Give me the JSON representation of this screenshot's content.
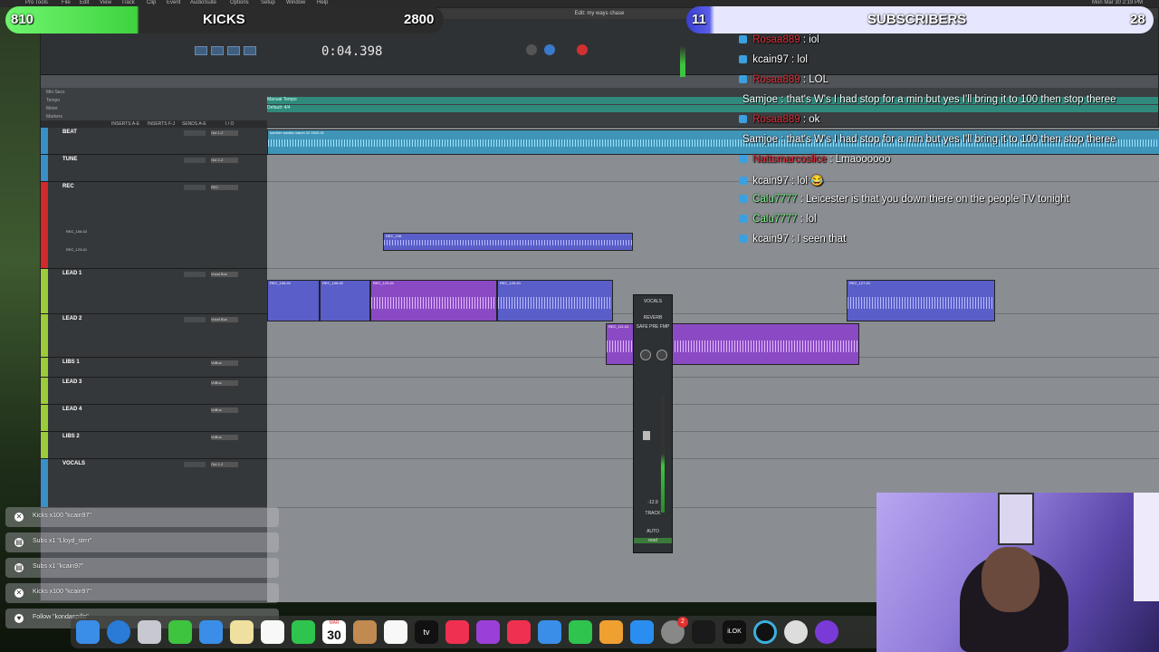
{
  "menubar": {
    "items": [
      "Pro Tools",
      "File",
      "Edit",
      "View",
      "Track",
      "Clip",
      "Event",
      "AudioSuite",
      "Options",
      "Setup",
      "Window",
      "Help"
    ],
    "clock": "Mon Mar 30  2:19 PM"
  },
  "protools": {
    "window_title": "Edit: my ways chase",
    "counter": "0:04.398",
    "track_columns": [
      "INSERTS A-E",
      "INSERTS F-J",
      "SENDS A-E",
      "I / O"
    ],
    "rulers": [
      "Min:Secs",
      "Tempo",
      "Meter",
      "Markers"
    ],
    "tempo_text": "Manual Tempo",
    "meter_text": "Default: 4/4",
    "tracks": [
      {
        "name": "BEAT",
        "color": "#3a8fc4",
        "io": "Out 1-2"
      },
      {
        "name": "TUNE",
        "color": "#3a8fc4",
        "io": "Out 1-2"
      },
      {
        "name": "REC",
        "color": "#d02a2a",
        "io": "REC"
      },
      {
        "name": "LEAD 1",
        "color": "#9bcc3a",
        "io": "Vocal Bus"
      },
      {
        "name": "LEAD 2",
        "color": "#9bcc3a",
        "io": "Vocal Bus"
      },
      {
        "name": "LIBS 1",
        "color": "#9bcc3a",
        "io": "VoBus"
      },
      {
        "name": "LEAD 3",
        "color": "#9bcc3a",
        "io": "VoBus"
      },
      {
        "name": "LEAD 4",
        "color": "#9bcc3a",
        "io": "VoBus"
      },
      {
        "name": "LIBS 2",
        "color": "#9bcc3a",
        "io": "VoBus"
      },
      {
        "name": "VOCALS",
        "color": "#3a8fc4",
        "io": "Out 1-2"
      }
    ],
    "rec_playlists": [
      "REC_106-02",
      "REC_123-01"
    ],
    "clips": {
      "beat": "somber samba march 22 2020-01",
      "rec": "REC_106",
      "lead1_a": "REC_106-01",
      "lead1_b": "REC_106-02",
      "lead1_c": "REC_123-01",
      "lead1_d": "REC_125-01",
      "lead1_e": "REC_127-01",
      "lead2": "REC_111-01",
      "gain": "0 dB"
    },
    "strip": {
      "name": "VOCALS",
      "insert": "REVERB",
      "safe": "SAFE",
      "pre": "PRE",
      "fmp": "FMP",
      "track_label": "TRACK",
      "auto_label": "AUTO",
      "mode": "read",
      "vol": "-12.9",
      "level": 0.45
    }
  },
  "overlay": {
    "left_count": "810",
    "left_label": "KICKS",
    "left_goal": "2800",
    "left_progress": 0.29,
    "left_color": "#5ee35e",
    "right_count": "11",
    "right_label": "SUBSCRIBERS",
    "right_goal": "28",
    "right_progress": 0.39,
    "right_color": "#5158e0"
  },
  "chat": [
    {
      "user": "Rosaa889",
      "user_color": "#e0303a",
      "text": " : iol"
    },
    {
      "user": "kcain97",
      "user_color": "#ffffff",
      "text": " : lol"
    },
    {
      "user": "Rosaa889",
      "user_color": "#e0303a",
      "text": " : LOL"
    },
    {
      "user": "Samjoe",
      "user_color": "#ffffff",
      "text": " : that's W's I had stop for a min but yes I'll bring it to 100 then stop theree"
    },
    {
      "user": "Rosaa889",
      "user_color": "#e0303a",
      "text": " : ok"
    },
    {
      "user": "Samjoe",
      "user_color": "#ffffff",
      "text": " : that's W's I had stop for a min but yes I'll bring it to 100 then stop theree"
    },
    {
      "user": "Nattsmarcoslice",
      "user_color": "#e0303a",
      "text": " : Lmaoooooo"
    },
    {
      "user": "kcain97",
      "user_color": "#ffffff",
      "text": " : lol 😂"
    },
    {
      "user": "Calu7777",
      "user_color": "#7ef28a",
      "text": " : Leicester is that you down there on the people TV tonight"
    },
    {
      "user": "Calu7777",
      "user_color": "#7ef28a",
      "text": " : lol"
    },
    {
      "user": "kcain97",
      "user_color": "#ffffff",
      "text": " : I seen that"
    }
  ],
  "alerts": [
    {
      "icon": "kick-icon",
      "text": "Kicks x100 \"kcain97\""
    },
    {
      "icon": "subscriber-icon",
      "text": "Subs x1 \"Lloyd_strrr\""
    },
    {
      "icon": "subscriber-icon",
      "text": "Subs x1 \"kcain97\""
    },
    {
      "icon": "kick-icon",
      "text": "Kicks x100 \"kcain97\""
    },
    {
      "icon": "heart-icon",
      "text": "Follow \"kondaspills\""
    }
  ],
  "dock": {
    "calendar_month": "MAR",
    "calendar_day": "30",
    "icons": [
      "finder-icon",
      "safari-icon",
      "launchpad-icon",
      "messages-icon",
      "mail-icon",
      "notes-icon",
      "photos-icon",
      "facetime-icon",
      "calendar-icon",
      "contacts-icon",
      "reminders-icon",
      "tv-icon",
      "music-icon",
      "podcasts-icon",
      "news-icon",
      "keynote-icon",
      "numbers-icon",
      "pages-icon",
      "app-store-icon",
      "system-preferences-icon",
      "pro-tools-icon",
      "ilok-icon",
      "obs-icon",
      "streamlabs-icon",
      "avid-icon"
    ],
    "notification_badge": "2"
  }
}
